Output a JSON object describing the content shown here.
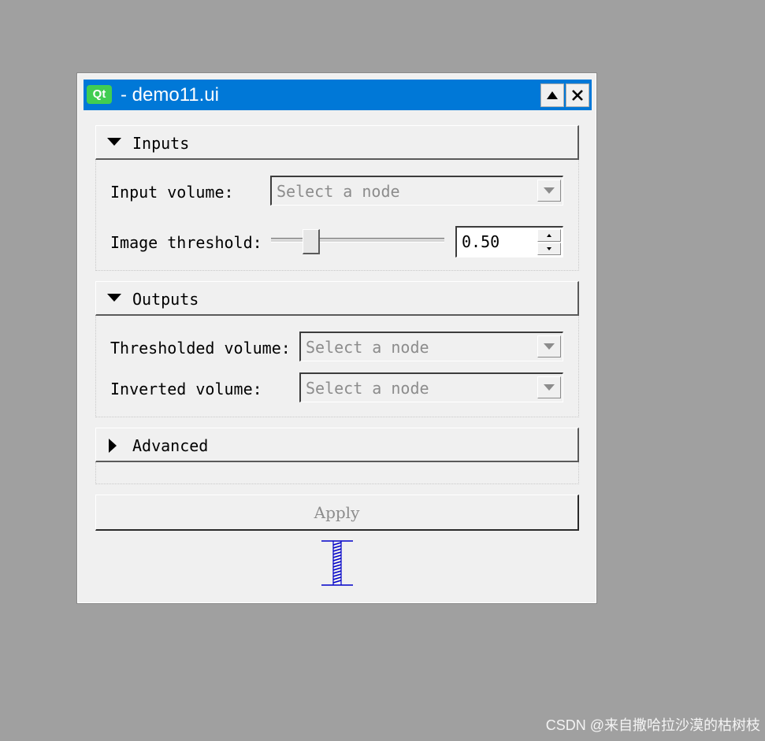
{
  "window": {
    "logo_text": "Qt",
    "title": "- demo11.ui"
  },
  "sections": [
    {
      "label": "Inputs",
      "expanded": true,
      "rows": [
        {
          "label": "Input volume:",
          "widget": "combo",
          "placeholder": "Select a node"
        },
        {
          "label": "Image threshold:",
          "widget": "slider-spin",
          "value": "0.50",
          "slider_fraction": 0.2
        }
      ]
    },
    {
      "label": "Outputs",
      "expanded": true,
      "rows": [
        {
          "label": "Thresholded volume:",
          "widget": "combo",
          "placeholder": "Select a node"
        },
        {
          "label": "Inverted volume:",
          "widget": "combo",
          "placeholder": "Select a node"
        }
      ]
    },
    {
      "label": "Advanced",
      "expanded": false,
      "rows": []
    }
  ],
  "apply_button": {
    "label": "Apply",
    "enabled": false
  },
  "watermark": "CSDN @来自撒哈拉沙漠的枯树枝",
  "colors": {
    "background": "#a0a0a0",
    "titlebar": "#0078d7",
    "qt_logo": "#41cd52",
    "spacer": "#0000c8"
  }
}
